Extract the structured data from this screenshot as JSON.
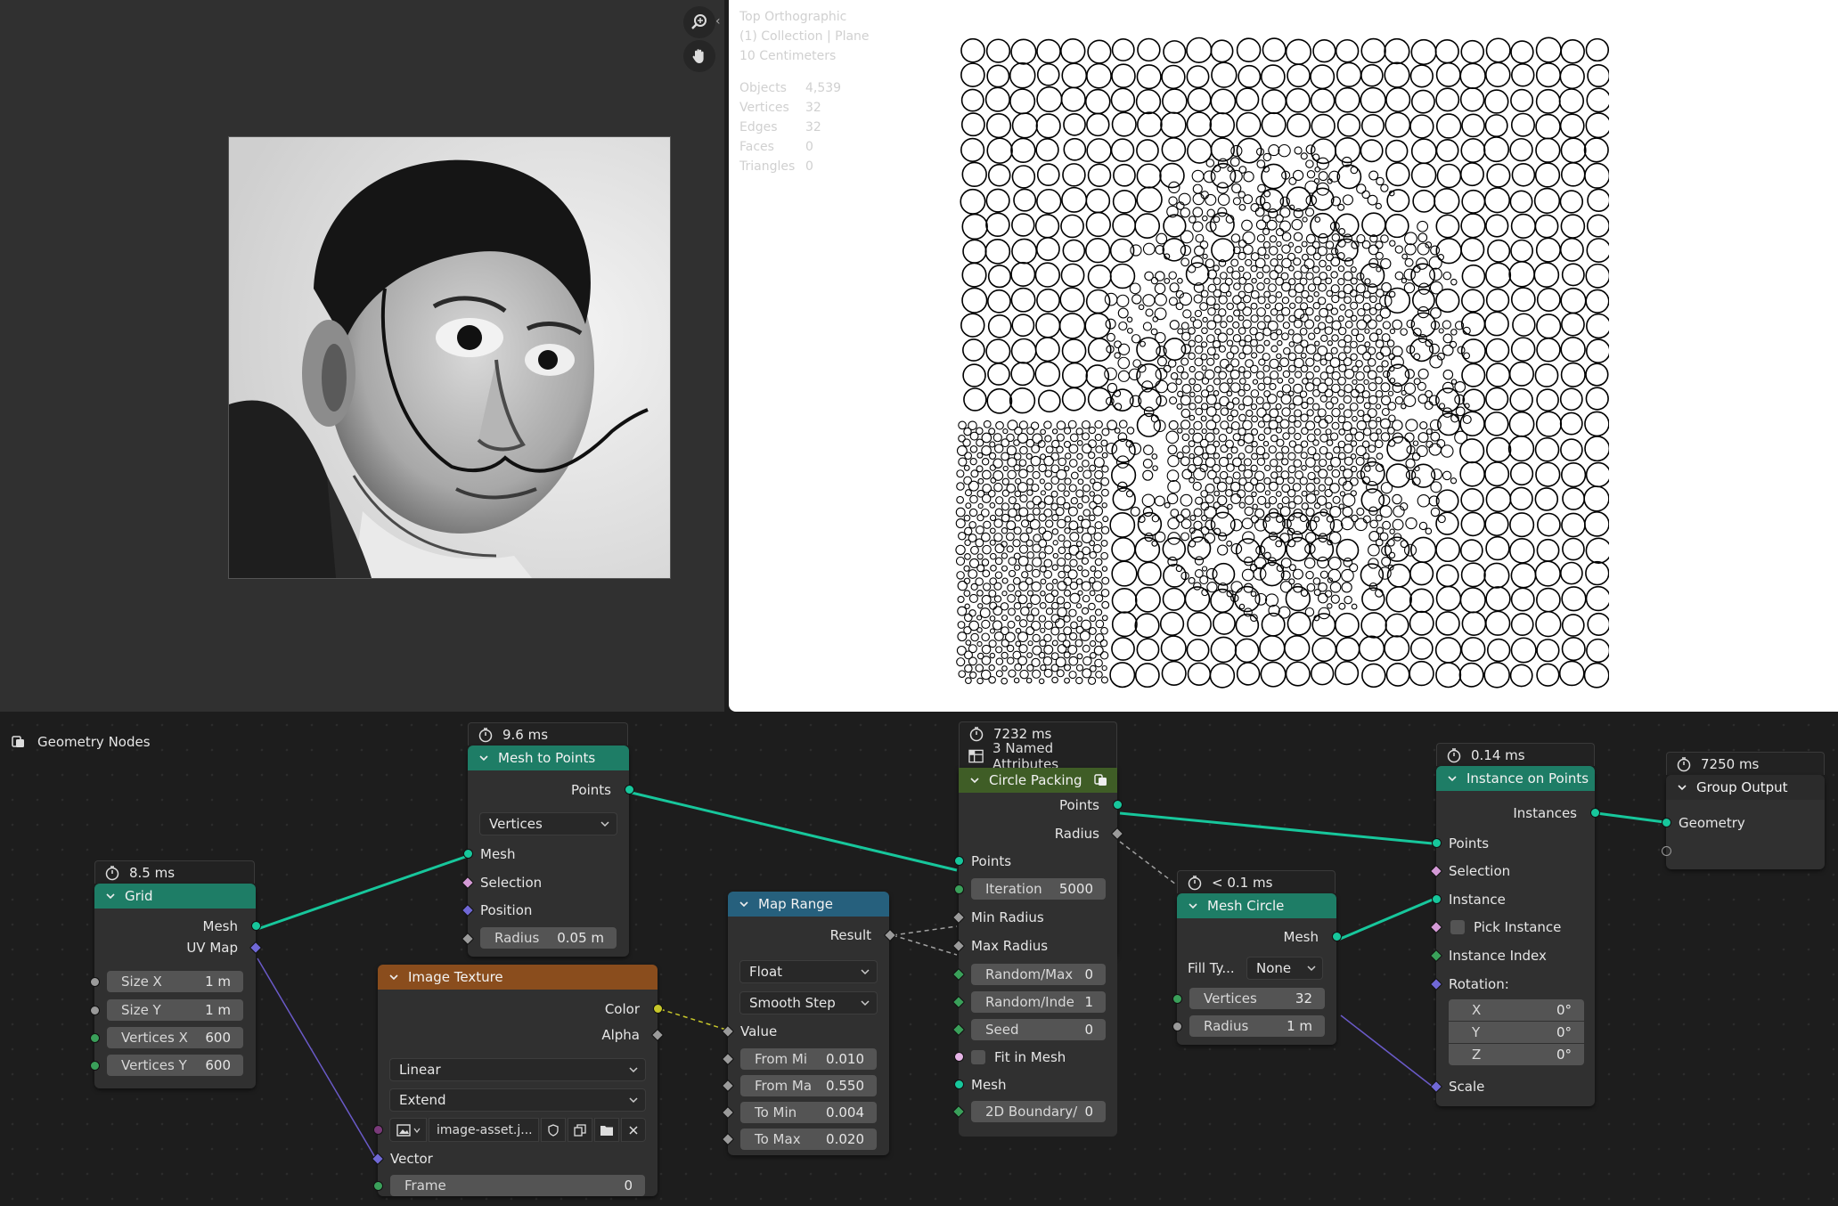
{
  "viewport": {
    "view_name": "Top Orthographic",
    "collection": "(1) Collection | Plane",
    "scale": "10 Centimeters",
    "stats": [
      {
        "label": "Objects",
        "value": "4,539"
      },
      {
        "label": "Vertices",
        "value": "32"
      },
      {
        "label": "Edges",
        "value": "32"
      },
      {
        "label": "Faces",
        "value": "0"
      },
      {
        "label": "Triangles",
        "value": "0"
      }
    ]
  },
  "editor": {
    "title": "Geometry Nodes"
  },
  "colors": {
    "geometry_node": "#1e7d66",
    "input_node": "#8a4d1d",
    "converter_node": "#26607d",
    "group_node": "#3f5d26",
    "output_node": "#2b2b2b"
  },
  "nodes": {
    "grid": {
      "time": "8.5 ms",
      "title": "Grid",
      "outputs": [
        "Mesh",
        "UV Map"
      ],
      "fields": [
        {
          "label": "Size X",
          "value": "1 m"
        },
        {
          "label": "Size Y",
          "value": "1 m"
        },
        {
          "label": "Vertices X",
          "value": "600"
        },
        {
          "label": "Vertices Y",
          "value": "600"
        }
      ]
    },
    "mesh_to_points": {
      "time": "9.6 ms",
      "title": "Mesh to Points",
      "output": "Points",
      "mode": "Vertices",
      "inputs": [
        "Mesh",
        "Selection",
        "Position"
      ],
      "radius_label": "Radius",
      "radius_value": "0.05 m"
    },
    "image_texture": {
      "title": "Image Texture",
      "outputs": [
        "Color",
        "Alpha"
      ],
      "interpolation": "Linear",
      "extension": "Extend",
      "image_name": "image-asset.j...",
      "vector_label": "Vector",
      "frame_label": "Frame",
      "frame_value": "0"
    },
    "map_range": {
      "title": "Map Range",
      "output": "Result",
      "data_type": "Float",
      "interpolation": "Smooth Step",
      "value_label": "Value",
      "fields": [
        {
          "label": "From Mi",
          "value": "0.010"
        },
        {
          "label": "From Ma",
          "value": "0.550"
        },
        {
          "label": "To Min",
          "value": "0.004"
        },
        {
          "label": "To Max",
          "value": "0.020"
        }
      ]
    },
    "circle_packing": {
      "time": "7232 ms",
      "attributes": "3 Named Attributes",
      "title": "Circle Packing",
      "outputs": [
        "Points",
        "Radius"
      ],
      "inputs": [
        "Points",
        "Min Radius",
        "Max Radius"
      ],
      "fields": [
        {
          "label": "Iteration",
          "value": "5000"
        },
        {
          "label": "Random/Max",
          "value": "0"
        },
        {
          "label": "Random/Inde",
          "value": "1"
        },
        {
          "label": "Seed",
          "value": "0"
        },
        {
          "label": "2D Boundary/",
          "value": "0"
        }
      ],
      "fit_label": "Fit in Mesh",
      "mesh_label": "Mesh"
    },
    "mesh_circle": {
      "time": "< 0.1 ms",
      "title": "Mesh Circle",
      "output": "Mesh",
      "fill_label": "Fill Ty...",
      "fill_value": "None",
      "fields": [
        {
          "label": "Vertices",
          "value": "32"
        },
        {
          "label": "Radius",
          "value": "1 m"
        }
      ]
    },
    "instance_on_points": {
      "time": "0.14 ms",
      "title": "Instance on Points",
      "output": "Instances",
      "inputs": [
        "Points",
        "Selection",
        "Instance",
        "Pick Instance",
        "Instance Index",
        "Rotation:",
        "Scale"
      ],
      "rotation": [
        {
          "label": "X",
          "value": "0°"
        },
        {
          "label": "Y",
          "value": "0°"
        },
        {
          "label": "Z",
          "value": "0°"
        }
      ]
    },
    "group_output": {
      "time": "7250 ms",
      "title": "Group Output",
      "input": "Geometry"
    }
  }
}
